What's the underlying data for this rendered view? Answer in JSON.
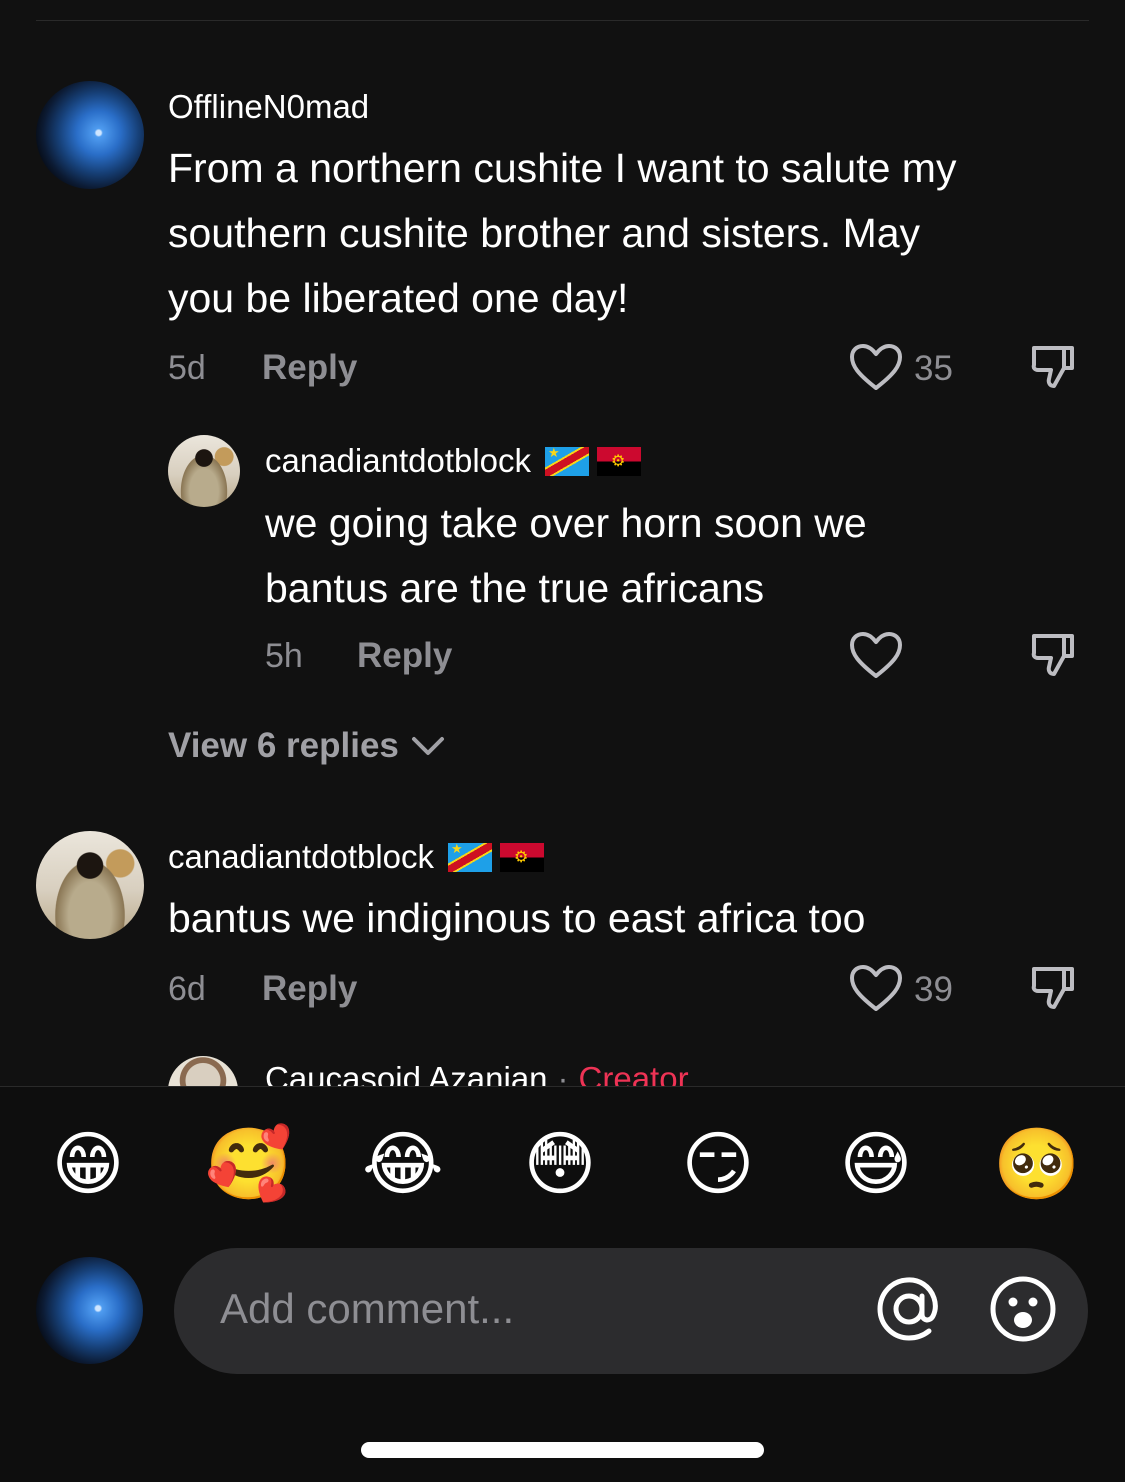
{
  "comments": [
    {
      "username": "OfflineN0mad",
      "text_lines": [
        "From a northern cushite I want to salute my",
        "southern cushite brother and sisters. May",
        "you be liberated one day!"
      ],
      "time": "5d",
      "reply_label": "Reply",
      "likes": "35"
    },
    {
      "username": "canadiantdotblock",
      "flags": [
        "🇨🇩",
        "🇦🇴"
      ],
      "text_lines": [
        "we going take over horn soon we",
        "bantus are the true africans"
      ],
      "time": "5h",
      "reply_label": "Reply",
      "likes": ""
    },
    {
      "username": "canadiantdotblock",
      "flags": [
        "🇨🇩",
        "🇦🇴"
      ],
      "text_lines": [
        "bantus we indiginous to east africa too"
      ],
      "time": "6d",
      "reply_label": "Reply",
      "likes": "39"
    }
  ],
  "view_replies": "View 6 replies",
  "next_comment": {
    "username": "Caucasoid Azanian",
    "separator": "·",
    "badge": "Creator"
  },
  "emoji_bar": [
    "😁",
    "🥰",
    "😂",
    "😳",
    "😏",
    "😅",
    "🥺"
  ],
  "comment_input": {
    "placeholder": "Add comment..."
  },
  "icons": {
    "like": "heart-outline-icon",
    "dislike": "thumbs-down-icon",
    "mention": "at-sign-icon",
    "emoji": "smiley-face-icon",
    "expand": "chevron-down-icon"
  },
  "colors": {
    "background": "#111111",
    "secondary_text": "#8e8e93",
    "creator_badge": "#ee3355",
    "input_bg": "#2c2c2e"
  }
}
